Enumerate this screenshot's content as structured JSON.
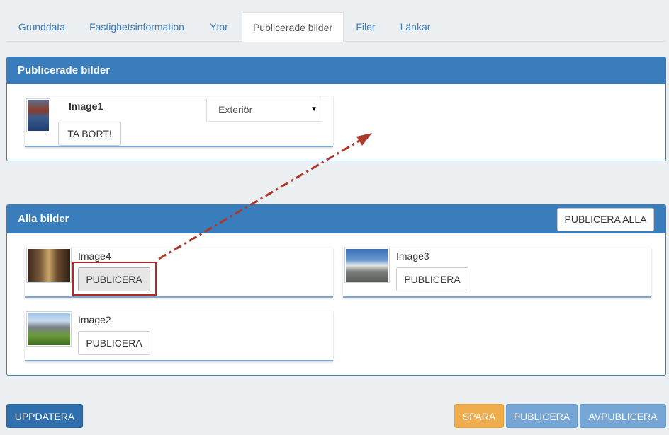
{
  "tabs": [
    {
      "label": "Grunddata"
    },
    {
      "label": "Fastighetsinformation"
    },
    {
      "label": "Ytor"
    },
    {
      "label": "Publicerade bilder",
      "active": true
    },
    {
      "label": "Filer"
    },
    {
      "label": "Länkar"
    }
  ],
  "published": {
    "title": "Publicerade bilder",
    "items": [
      {
        "name": "Image1",
        "category": "Exteriör",
        "remove_label": "TA BORT!"
      }
    ]
  },
  "all_images": {
    "title": "Alla bilder",
    "publish_all_label": "PUBLICERA ALLA",
    "items": [
      {
        "name": "Image4",
        "button_label": "PUBLICERA"
      },
      {
        "name": "Image3",
        "button_label": "PUBLICERA"
      },
      {
        "name": "Image2",
        "button_label": "PUBLICERA"
      }
    ]
  },
  "footer": {
    "update_label": "UPPDATERA",
    "save_label": "SPARA",
    "publish_label": "PUBLICERA",
    "unpublish_label": "AVPUBLICERA"
  },
  "colors": {
    "primary": "#3a7dbd",
    "warning": "#f0ad4e",
    "muted_primary": "#76a6d6",
    "annotation": "#b0382a"
  }
}
